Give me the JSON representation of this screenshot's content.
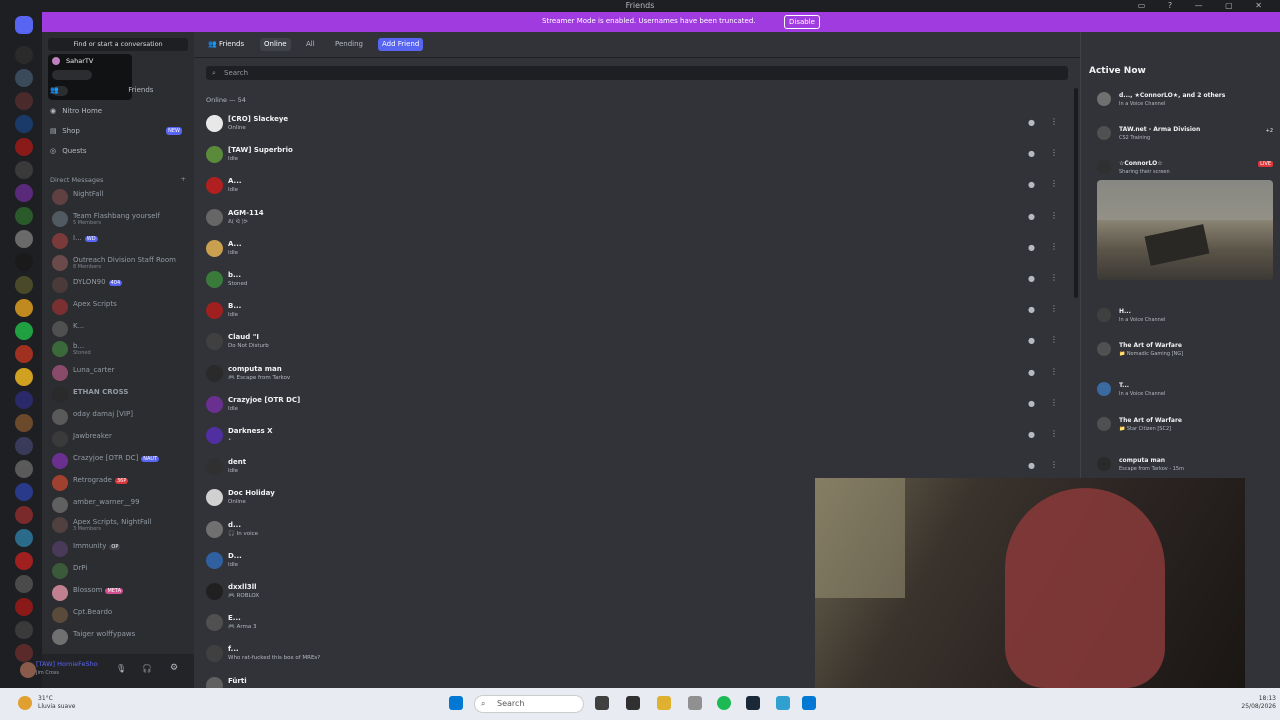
{
  "window": {
    "title": "Friends"
  },
  "streamer_banner": {
    "message": "Streamer Mode is enabled. Usernames have been truncated.",
    "disable_label": "Disable"
  },
  "sidebar": {
    "find_label": "Find or start a conversation",
    "nav": [
      {
        "label": "Friends"
      },
      {
        "label": "Nitro Home"
      },
      {
        "label": "Shop",
        "badge": "NEW"
      },
      {
        "label": "Quests"
      }
    ],
    "dm_header": "Direct Messages",
    "dms": [
      {
        "name": "NightFall",
        "sub": ""
      },
      {
        "name": "Team Flashbang yourself",
        "sub": "5 Members"
      },
      {
        "name": "I...",
        "sub": "",
        "tag": "WD"
      },
      {
        "name": "Outreach Division Staff Room",
        "sub": "8 Members"
      },
      {
        "name": "DYLON90",
        "sub": "",
        "tag": "404"
      },
      {
        "name": "Apex Scripts",
        "sub": ""
      },
      {
        "name": "K...",
        "sub": ""
      },
      {
        "name": "b...",
        "sub": "Stoned"
      },
      {
        "name": "Luna_carter",
        "sub": ""
      },
      {
        "name": "ETHAN CROSS",
        "sub": ""
      },
      {
        "name": "oday damaj [VIP]",
        "sub": ""
      },
      {
        "name": "Jawbreaker",
        "sub": ""
      },
      {
        "name": "Crazyjoe [OTR DC]",
        "sub": "",
        "tag": "NAUT"
      },
      {
        "name": "Retrograde",
        "sub": "",
        "tag": "36P"
      },
      {
        "name": "amber_warner__99",
        "sub": ""
      },
      {
        "name": "Apex Scripts, NightFall",
        "sub": "3 Members"
      },
      {
        "name": "Immunity",
        "sub": "",
        "tag": "OP"
      },
      {
        "name": "DrPi",
        "sub": ""
      },
      {
        "name": "Blossom",
        "sub": "",
        "tag": "META"
      },
      {
        "name": "Cpt.Beardo",
        "sub": ""
      },
      {
        "name": "Taiger wolffypaws",
        "sub": ""
      }
    ],
    "user": {
      "name": "[TAW] HomieFeSho",
      "status": "Jim Cross",
      "popup_name": "SaharTV"
    }
  },
  "topbar": {
    "title": "Friends",
    "tabs": [
      "Online",
      "All",
      "Pending"
    ],
    "add_friend": "Add Friend"
  },
  "search": {
    "placeholder": "Search"
  },
  "online_count": "Online — 54",
  "friends": [
    {
      "name": "[CRO] Slackeye",
      "status": "Online",
      "color": "#e8e8e8"
    },
    {
      "name": "[TAW] Superbrio",
      "status": "Idle",
      "color": "#5a8a3a"
    },
    {
      "name": "A...",
      "status": "Idle",
      "color": "#b02020"
    },
    {
      "name": "AGM-114",
      "status": "ᕕ( ᐛ )ᕗ",
      "color": "#666666"
    },
    {
      "name": "A...",
      "status": "Idle",
      "color": "#c8a050"
    },
    {
      "name": "b...",
      "status": "Stoned",
      "color": "#3a7a3a"
    },
    {
      "name": "B...",
      "status": "Idle",
      "color": "#a02020"
    },
    {
      "name": "Claud \"I",
      "status": "Do Not Disturb",
      "color": "#404040"
    },
    {
      "name": "computa man",
      "status": "🎮 Escape from Tarkov",
      "color": "#2a2a2a"
    },
    {
      "name": "Crazyjoe [OTR DC]",
      "status": "Idle",
      "color": "#6a3090"
    },
    {
      "name": "Darkness X",
      "status": "•",
      "color": "#5030a0"
    },
    {
      "name": "dent",
      "status": "Idle",
      "color": "#303030"
    },
    {
      "name": "Doc Holiday",
      "status": "Online",
      "color": "#d0d0d0"
    },
    {
      "name": "d...",
      "status": "🎧 In voice",
      "color": "#707070"
    },
    {
      "name": "D...",
      "status": "Idle",
      "color": "#3060a0"
    },
    {
      "name": "dxxll3ll",
      "status": "🎮 ROBLOX",
      "color": "#202020"
    },
    {
      "name": "E...",
      "status": "🎮 Arma 3",
      "color": "#505050"
    },
    {
      "name": "f...",
      "status": "Who rat-fucked this box of MREs?",
      "color": "#404040"
    },
    {
      "name": "Fürti",
      "status": "",
      "color": "#606060"
    }
  ],
  "active_now": {
    "title": "Active Now",
    "items": [
      {
        "title": "d..., ★ConnorLO★, and 2 others",
        "sub": "In a Voice Channel"
      },
      {
        "title": "TAW.net - Arma Division",
        "sub": "CS2 Training",
        "extra": "+2"
      },
      {
        "title": "☆ConnorLO☆",
        "sub": "Sharing their screen",
        "live": "LIVE"
      },
      {
        "title": "H...",
        "sub": "In a Voice Channel"
      },
      {
        "title": "The Art of Warfare",
        "sub": "📁 Nomadic Gaming [NG]"
      },
      {
        "title": "T...",
        "sub": "In a Voice Channel"
      },
      {
        "title": "The Art of Warfare",
        "sub": "📁 Star Citizen [SC2]"
      },
      {
        "title": "computa man",
        "sub": "Escape from Tarkov - 15m"
      }
    ]
  },
  "taskbar": {
    "weather_temp": "31°C",
    "weather_desc": "Lluvia suave",
    "search": "Search",
    "time": "18:13",
    "date": "25/08/2026"
  },
  "colors": {
    "accent": "#5865f2",
    "banner": "#a03be0"
  }
}
